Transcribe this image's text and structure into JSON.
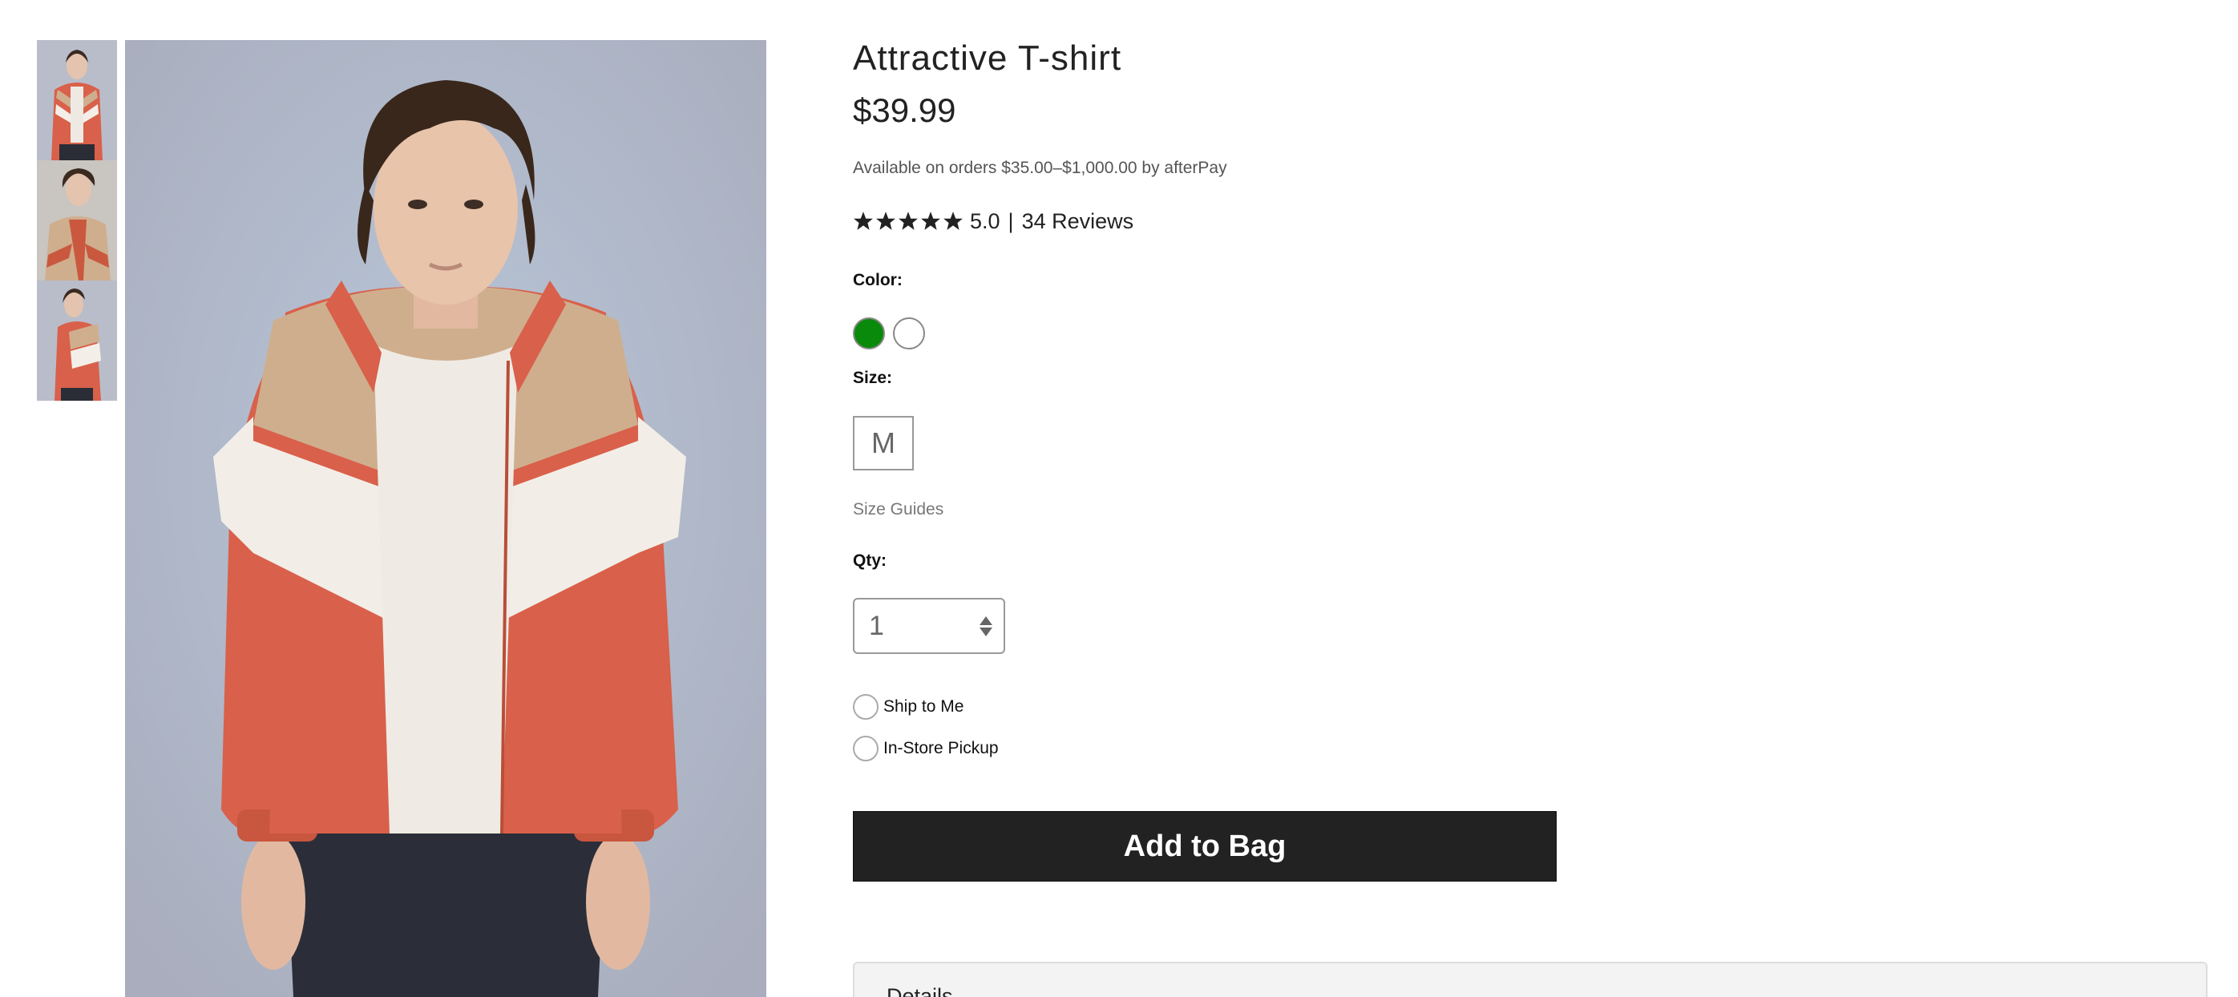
{
  "product": {
    "title": "Attractive T-shirt",
    "price": "$39.99",
    "afterpay_text": "Available on orders $35.00–$1,000.00 by afterPay",
    "rating": {
      "stars": 5,
      "score": "5.0",
      "separator": "|",
      "reviews": "34 Reviews"
    }
  },
  "gallery": {
    "thumbnails": [
      "front-view",
      "side-view",
      "back-view"
    ]
  },
  "options": {
    "color_label": "Color:",
    "colors": [
      {
        "name": "green",
        "hex": "#0a8a0a"
      },
      {
        "name": "white",
        "hex": "#ffffff"
      }
    ],
    "size_label": "Size:",
    "size_value": "M",
    "size_guide": "Size Guides",
    "qty_label": "Qty:",
    "qty_value": "1"
  },
  "delivery": {
    "ship_label": "Ship to Me",
    "pickup_label": "In-Store Pickup"
  },
  "actions": {
    "add_to_bag": "Add to Bag"
  },
  "details": {
    "title": "Details"
  },
  "theme": {
    "button_bg": "#222222",
    "jacket_orange": "#d9604a",
    "jacket_tan": "#cfae8e",
    "photo_bg": "#b9bdca"
  }
}
